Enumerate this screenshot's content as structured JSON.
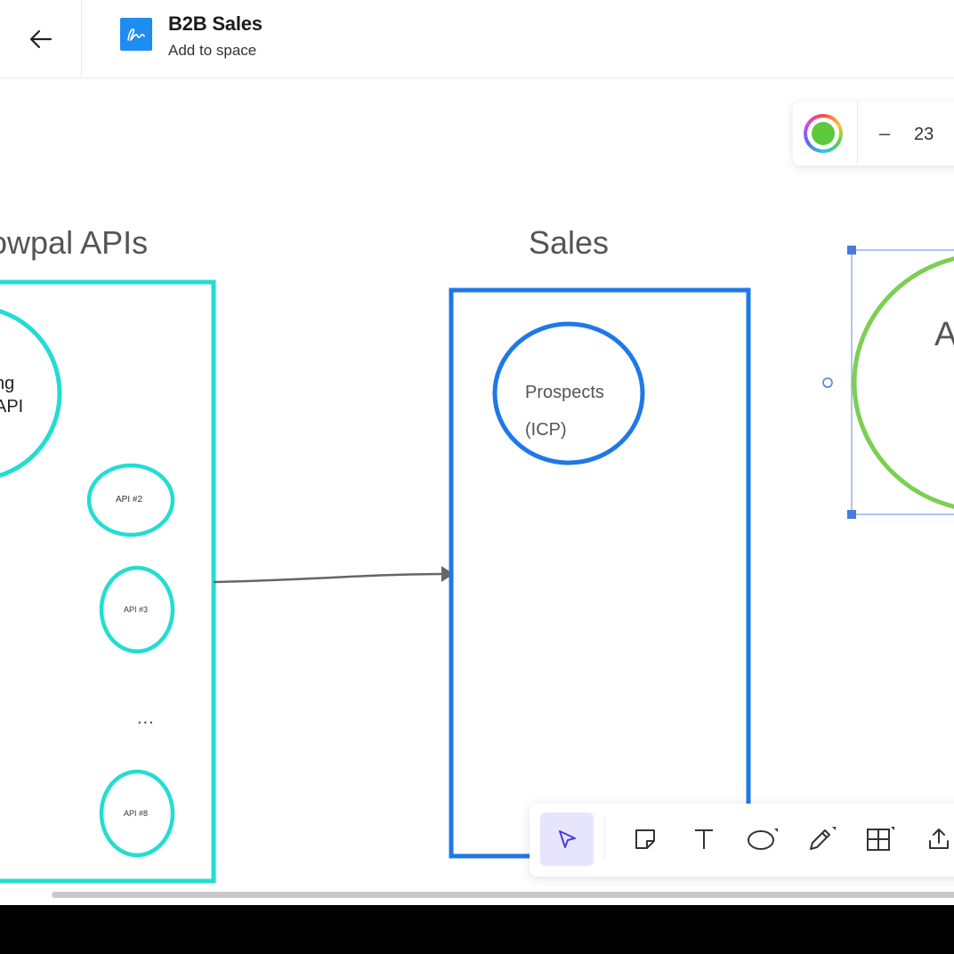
{
  "header": {
    "title": "B2B Sales",
    "subtitle": "Add to space"
  },
  "style_toolbar": {
    "color_value": "#5cc83b",
    "size_value": "23",
    "decrease_label": "–"
  },
  "canvas": {
    "apis_frame_label": "owpal APIs",
    "sales_frame_label": "Sales",
    "main_api_line1": "ng",
    "main_api_line2": "API",
    "api_items": [
      "API #2",
      "API #3",
      "API #8"
    ],
    "ellipsis": "...",
    "prospects_line1": "Prospects",
    "prospects_line2": "(ICP)",
    "green_circle_letter": "A"
  },
  "colors": {
    "apis_frame": "#22ddd2",
    "sales_frame": "#1f78e8",
    "selected_circle": "#7ccf52",
    "selection_handles": "#4a7bdc",
    "connector": "#666666",
    "brand": "#1f8cf2"
  },
  "bottom_toolbar": {
    "tools": [
      "select-icon",
      "sticky-note-icon",
      "text-icon",
      "shape-icon",
      "pen-icon",
      "table-icon",
      "upload-icon"
    ],
    "active_tool": "select-icon"
  }
}
